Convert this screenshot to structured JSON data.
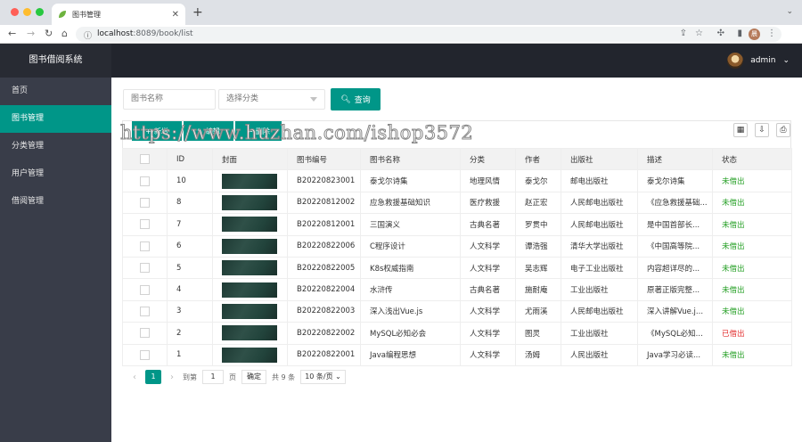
{
  "browser": {
    "tab_title": "图书管理",
    "url_host": "localhost",
    "url_rest": ":8089/book/list",
    "profile_initial": "晨"
  },
  "app": {
    "title": "图书借阅系统",
    "menu": [
      "首页",
      "图书管理",
      "分类管理",
      "用户管理",
      "借阅管理"
    ],
    "user": "admin"
  },
  "search": {
    "name_placeholder": "图书名称",
    "category_placeholder": "选择分类",
    "button": "查询"
  },
  "toolbar": {
    "add": "新增",
    "edit": "编辑",
    "delete": "删除"
  },
  "watermark": "https://www.huzhan.com/ishop3572",
  "table": {
    "headers": [
      "",
      "ID",
      "封面",
      "图书编号",
      "图书名称",
      "分类",
      "作者",
      "出版社",
      "描述",
      "状态"
    ],
    "rows": [
      {
        "id": "10",
        "code": "B20220823001",
        "name": "泰戈尔诗集",
        "category": "地理风情",
        "author": "泰戈尔",
        "publisher": "邮电出版社",
        "desc": "泰戈尔诗集",
        "status": "未借出",
        "status_color": "#1e9c1e"
      },
      {
        "id": "8",
        "code": "B20220812002",
        "name": "应急救援基础知识",
        "category": "医疗救援",
        "author": "赵正宏",
        "publisher": "人民邮电出版社",
        "desc": "《应急救援基础...",
        "status": "未借出",
        "status_color": "#1e9c1e"
      },
      {
        "id": "7",
        "code": "B20220812001",
        "name": "三国演义",
        "category": "古典名著",
        "author": "罗贯中",
        "publisher": "人民邮电出版社",
        "desc": "是中国首部长...",
        "status": "未借出",
        "status_color": "#1e9c1e"
      },
      {
        "id": "6",
        "code": "B20220822006",
        "name": "C程序设计",
        "category": "人文科学",
        "author": "谭浩强",
        "publisher": "清华大学出版社",
        "desc": "《中国高等院...",
        "status": "未借出",
        "status_color": "#1e9c1e"
      },
      {
        "id": "5",
        "code": "B20220822005",
        "name": "K8s权威指南",
        "category": "人文科学",
        "author": "吴志辉",
        "publisher": "电子工业出版社",
        "desc": "内容超详尽的...",
        "status": "未借出",
        "status_color": "#1e9c1e"
      },
      {
        "id": "4",
        "code": "B20220822004",
        "name": "水浒传",
        "category": "古典名著",
        "author": "施耐庵",
        "publisher": "工业出版社",
        "desc": "原著正版完整...",
        "status": "未借出",
        "status_color": "#1e9c1e"
      },
      {
        "id": "3",
        "code": "B20220822003",
        "name": "深入浅出Vue.js",
        "category": "人文科学",
        "author": "尤雨溪",
        "publisher": "人民邮电出版社",
        "desc": "深入讲解Vue.j...",
        "status": "未借出",
        "status_color": "#1e9c1e"
      },
      {
        "id": "2",
        "code": "B20220822002",
        "name": "MySQL必知必会",
        "category": "人文科学",
        "author": "图灵",
        "publisher": "工业出版社",
        "desc": "《MySQL必知...",
        "status": "已借出",
        "status_color": "#e22c2c"
      },
      {
        "id": "1",
        "code": "B20220822001",
        "name": "Java编程思想",
        "category": "人文科学",
        "author": "汤姆",
        "publisher": "人民出版社",
        "desc": "Java学习必读...",
        "status": "未借出",
        "status_color": "#1e9c1e"
      }
    ]
  },
  "pager": {
    "current": "1",
    "goto_label": "到第",
    "goto_value": "1",
    "page_unit": "页",
    "confirm": "确定",
    "total": "共 9 条",
    "page_size": "10 条/页"
  }
}
